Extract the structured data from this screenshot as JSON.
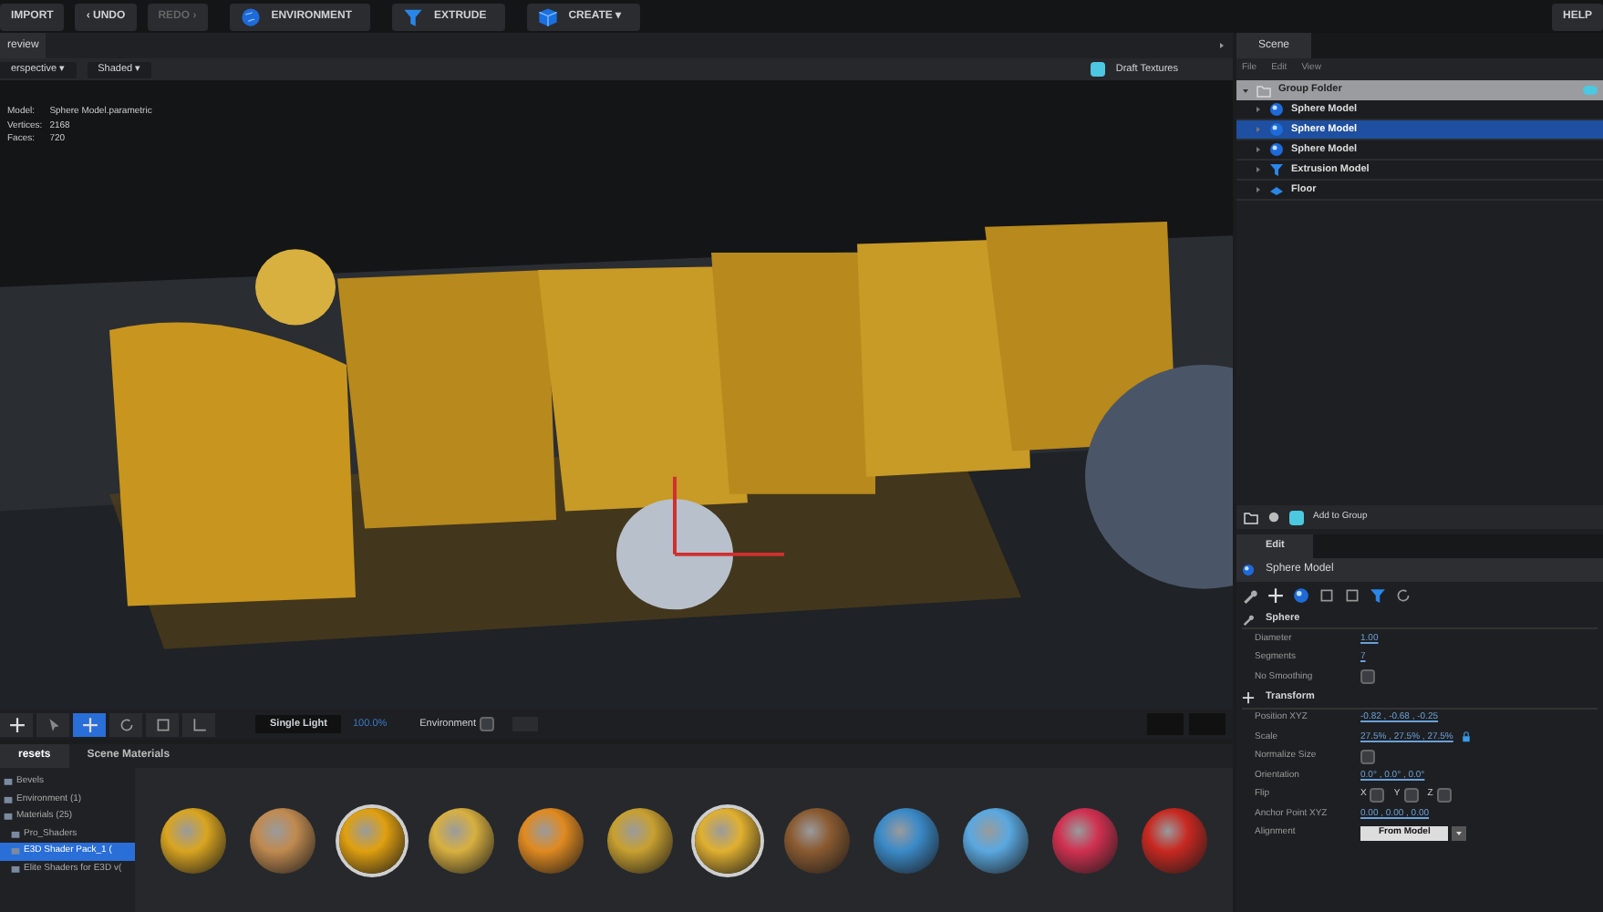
{
  "toolbar": {
    "buttons": [
      {
        "label": "IMPORT",
        "disabled": false
      },
      {
        "label": "‹ UNDO",
        "disabled": false
      },
      {
        "label": "REDO ›",
        "disabled": true
      },
      {
        "label": "ENVIRONMENT",
        "disabled": false
      },
      {
        "label": "EXTRUDE",
        "disabled": false
      },
      {
        "label": "CREATE ▾",
        "disabled": false
      }
    ],
    "help": "HELP"
  },
  "viewport": {
    "tab": "review",
    "dropdowns": [
      "erspective ▾",
      "Shaded ▾"
    ],
    "draft_textures": {
      "label": "Draft Textures",
      "checked": true
    },
    "info": [
      {
        "label": "Model:",
        "value": "Sphere Model.parametric"
      },
      {
        "label": "Vertices:",
        "value": "2168"
      },
      {
        "label": "Faces:",
        "value": "720"
      }
    ],
    "tools": [
      {
        "selected": false
      },
      {
        "selected": false
      },
      {
        "selected": true
      },
      {
        "selected": false
      },
      {
        "selected": false
      },
      {
        "selected": false
      }
    ],
    "light": "Single Light",
    "zoom": "100.0%",
    "environment": {
      "label": "Environment",
      "checked": false
    }
  },
  "scene": {
    "tab": "Scene",
    "menu": [
      "File",
      "Edit",
      "View"
    ],
    "tree": [
      {
        "label": "Group Folder",
        "kind": "folder",
        "expanded": true,
        "selected": false,
        "children": [
          {
            "label": "Sphere Model",
            "kind": "sphere",
            "selected": false
          },
          {
            "label": "Sphere Model",
            "kind": "sphere",
            "selected": true
          },
          {
            "label": "Sphere Model",
            "kind": "sphere",
            "selected": false
          },
          {
            "label": "Extrusion Model",
            "kind": "extrusion",
            "selected": false
          },
          {
            "label": "Floor",
            "kind": "floor",
            "selected": false
          }
        ]
      }
    ],
    "add_to_group": {
      "label": "Add to Group",
      "checked": true
    }
  },
  "edit": {
    "tab": "Edit",
    "title": "Sphere Model",
    "sections": [
      {
        "title": "Sphere",
        "rows": [
          {
            "kind": "value",
            "label": "Diameter",
            "value": "1.00"
          },
          {
            "kind": "value",
            "label": "Segments",
            "value": "7"
          },
          {
            "kind": "check",
            "label": "No Smoothing",
            "checked": false
          }
        ]
      },
      {
        "title": "Transform",
        "rows": [
          {
            "kind": "value",
            "label": "Position XYZ",
            "value": "-0.82 ,  -0.68 ,  -0.25"
          },
          {
            "kind": "value",
            "label": "Scale",
            "value": "27.5% ,  27.5% ,  27.5%",
            "locked": true
          },
          {
            "kind": "check",
            "label": "Normalize Size",
            "checked": false
          },
          {
            "kind": "value",
            "label": "Orientation",
            "value": "0.0° ,  0.0° ,  0.0°"
          },
          {
            "kind": "flip",
            "label": "Flip",
            "axes": [
              {
                "label": "X",
                "checked": false
              },
              {
                "label": "Y",
                "checked": false
              },
              {
                "label": "Z",
                "checked": false
              }
            ]
          },
          {
            "kind": "value",
            "label": "Anchor Point XYZ",
            "value": "0.00 ,  0.00 ,  0.00"
          },
          {
            "kind": "dropdown",
            "label": "Alignment",
            "value": "From Model"
          }
        ]
      }
    ]
  },
  "library": {
    "tabs": [
      {
        "label": "resets",
        "selected": true
      },
      {
        "label": "Scene Materials",
        "selected": false
      }
    ],
    "tree": [
      {
        "label": "Bevels",
        "selected": false
      },
      {
        "label": "Environment (1)",
        "selected": false
      },
      {
        "label": "Materials (25)",
        "selected": false,
        "children": [
          {
            "label": "Pro_Shaders",
            "selected": false
          },
          {
            "label": "E3D Shader Pack_1 (",
            "selected": true
          },
          {
            "label": "Elite Shaders for E3D v(",
            "selected": false
          }
        ]
      }
    ],
    "materials": [
      {
        "color": "#d9a520",
        "selected": false
      },
      {
        "color": "#c08a50",
        "selected": false
      },
      {
        "color": "#e0a010",
        "selected": true
      },
      {
        "color": "#d8b040",
        "selected": false
      },
      {
        "color": "#e08a20",
        "selected": false
      },
      {
        "color": "#c8a030",
        "selected": false
      },
      {
        "color": "#e0b030",
        "selected": true
      },
      {
        "color": "#8a5a30",
        "selected": false
      },
      {
        "color": "#3a8ac8",
        "selected": false
      },
      {
        "color": "#5aa8e0",
        "selected": false
      },
      {
        "color": "#d03050",
        "selected": false
      },
      {
        "color": "#c82820",
        "selected": false
      }
    ]
  }
}
